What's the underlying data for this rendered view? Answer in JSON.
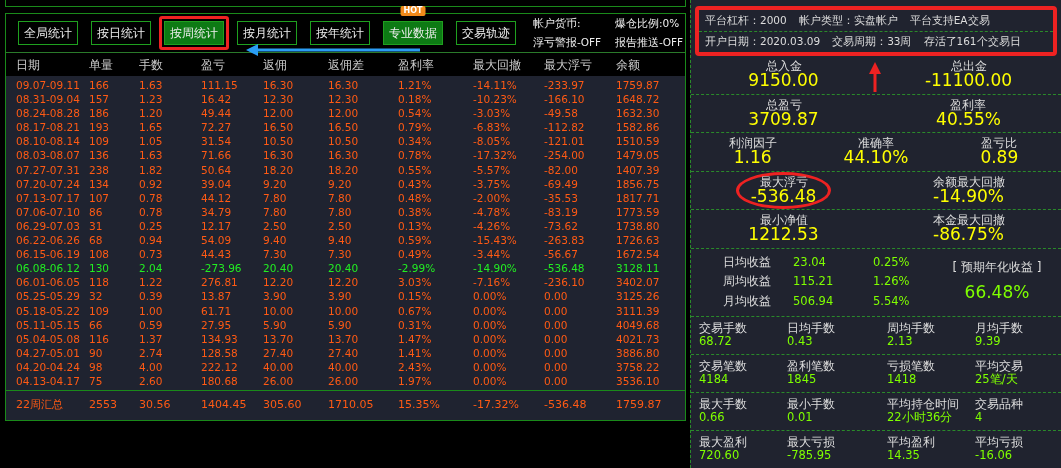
{
  "toolbar": {
    "buttons": [
      {
        "label": "全局统计",
        "selected": false,
        "highlighted": false
      },
      {
        "label": "按日统计",
        "selected": false,
        "highlighted": false
      },
      {
        "label": "按周统计",
        "selected": true,
        "highlighted": true
      },
      {
        "label": "按月统计",
        "selected": false,
        "highlighted": false
      },
      {
        "label": "按年统计",
        "selected": false,
        "highlighted": false
      },
      {
        "label": "专业数据",
        "selected": true,
        "highlighted": false,
        "badge": "HOT"
      },
      {
        "label": "交易轨迹",
        "selected": false,
        "highlighted": false
      }
    ],
    "info": [
      "帐户货币:",
      "爆仓比例:0%",
      "浮亏警报-OFF",
      "报告推送-OFF"
    ]
  },
  "table": {
    "columns": [
      "日期",
      "单量",
      "手数",
      "盈亏",
      "返佣",
      "返佣差",
      "盈利率",
      "最大回撤",
      "最大浮亏",
      "余额"
    ],
    "rows": [
      {
        "negative": false,
        "cells": [
          "09.07-09.11",
          "166",
          "1.63",
          "111.15",
          "16.30",
          "16.30",
          "1.21%",
          "-14.11%",
          "-233.97",
          "1759.87"
        ]
      },
      {
        "negative": false,
        "cells": [
          "08.31-09.04",
          "157",
          "1.23",
          "16.42",
          "12.30",
          "12.30",
          "0.18%",
          "-10.23%",
          "-166.10",
          "1648.72"
        ]
      },
      {
        "negative": false,
        "cells": [
          "08.24-08.28",
          "186",
          "1.20",
          "49.44",
          "12.00",
          "12.00",
          "0.54%",
          "-3.03%",
          "-49.58",
          "1632.30"
        ]
      },
      {
        "negative": false,
        "cells": [
          "08.17-08.21",
          "193",
          "1.65",
          "72.27",
          "16.50",
          "16.50",
          "0.79%",
          "-6.83%",
          "-112.82",
          "1582.86"
        ]
      },
      {
        "negative": false,
        "cells": [
          "08.10-08.14",
          "109",
          "1.05",
          "31.54",
          "10.50",
          "10.50",
          "0.34%",
          "-8.05%",
          "-121.01",
          "1510.59"
        ]
      },
      {
        "negative": false,
        "cells": [
          "08.03-08.07",
          "136",
          "1.63",
          "71.66",
          "16.30",
          "16.30",
          "0.78%",
          "-17.32%",
          "-254.00",
          "1479.05"
        ]
      },
      {
        "negative": false,
        "cells": [
          "07.27-07.31",
          "238",
          "1.82",
          "50.64",
          "18.20",
          "18.20",
          "0.55%",
          "-5.57%",
          "-82.00",
          "1407.39"
        ]
      },
      {
        "negative": false,
        "cells": [
          "07.20-07.24",
          "134",
          "0.92",
          "39.04",
          "9.20",
          "9.20",
          "0.43%",
          "-3.75%",
          "-69.49",
          "1856.75"
        ]
      },
      {
        "negative": false,
        "cells": [
          "07.13-07.17",
          "107",
          "0.78",
          "44.12",
          "7.80",
          "7.80",
          "0.48%",
          "-2.00%",
          "-35.53",
          "1817.71"
        ]
      },
      {
        "negative": false,
        "cells": [
          "07.06-07.10",
          "86",
          "0.78",
          "34.79",
          "7.80",
          "7.80",
          "0.38%",
          "-4.78%",
          "-83.19",
          "1773.59"
        ]
      },
      {
        "negative": false,
        "cells": [
          "06.29-07.03",
          "31",
          "0.25",
          "12.17",
          "2.50",
          "2.50",
          "0.13%",
          "-4.26%",
          "-73.62",
          "1738.80"
        ]
      },
      {
        "negative": false,
        "cells": [
          "06.22-06.26",
          "68",
          "0.94",
          "54.09",
          "9.40",
          "9.40",
          "0.59%",
          "-15.43%",
          "-263.83",
          "1726.63"
        ]
      },
      {
        "negative": false,
        "cells": [
          "06.15-06.19",
          "108",
          "0.73",
          "44.43",
          "7.30",
          "7.30",
          "0.49%",
          "-3.44%",
          "-56.67",
          "1672.54"
        ]
      },
      {
        "negative": true,
        "cells": [
          "06.08-06.12",
          "130",
          "2.04",
          "-273.96",
          "20.40",
          "20.40",
          "-2.99%",
          "-14.90%",
          "-536.48",
          "3128.11"
        ]
      },
      {
        "negative": false,
        "cells": [
          "06.01-06.05",
          "118",
          "1.22",
          "276.81",
          "12.20",
          "12.20",
          "3.03%",
          "-7.16%",
          "-236.10",
          "3402.07"
        ]
      },
      {
        "negative": false,
        "cells": [
          "05.25-05.29",
          "32",
          "0.39",
          "13.87",
          "3.90",
          "3.90",
          "0.15%",
          "0.00%",
          "0.00",
          "3125.26"
        ]
      },
      {
        "negative": false,
        "cells": [
          "05.18-05.22",
          "109",
          "1.00",
          "61.71",
          "10.00",
          "10.00",
          "0.67%",
          "0.00%",
          "0.00",
          "3111.39"
        ]
      },
      {
        "negative": false,
        "cells": [
          "05.11-05.15",
          "66",
          "0.59",
          "27.95",
          "5.90",
          "5.90",
          "0.31%",
          "0.00%",
          "0.00",
          "4049.68"
        ]
      },
      {
        "negative": false,
        "cells": [
          "05.04-05.08",
          "116",
          "1.37",
          "134.93",
          "13.70",
          "13.70",
          "1.47%",
          "0.00%",
          "0.00",
          "4021.73"
        ]
      },
      {
        "negative": false,
        "cells": [
          "04.27-05.01",
          "90",
          "2.74",
          "128.58",
          "27.40",
          "27.40",
          "1.41%",
          "0.00%",
          "0.00",
          "3886.80"
        ]
      },
      {
        "negative": false,
        "cells": [
          "04.20-04.24",
          "98",
          "4.00",
          "222.12",
          "40.00",
          "40.00",
          "2.43%",
          "0.00%",
          "0.00",
          "3758.22"
        ]
      },
      {
        "negative": false,
        "cells": [
          "04.13-04.17",
          "75",
          "2.60",
          "180.68",
          "26.00",
          "26.00",
          "1.97%",
          "0.00%",
          "0.00",
          "3536.10"
        ]
      }
    ],
    "summary": [
      "22周汇总",
      "2553",
      "30.56",
      "1404.45",
      "305.60",
      "1710.05",
      "15.35%",
      "-17.32%",
      "-536.48",
      "1759.87"
    ]
  },
  "account": {
    "highlighted": true,
    "lines": [
      [
        "平台杠杆：2000",
        "帐户类型：实盘帐户",
        "平台支持EA交易"
      ],
      [
        "开户日期：2020.03.09",
        "交易周期：33周",
        "存活了161个交易日"
      ]
    ]
  },
  "key_stats": [
    [
      {
        "label": "总入金",
        "value": "9150.00",
        "highlighted": false
      },
      {
        "label": "总出金",
        "value": "-11100.00",
        "highlighted": false
      }
    ],
    [
      {
        "label": "总盈亏",
        "value": "3709.87",
        "highlighted": false
      },
      {
        "label": "盈利率",
        "value": "40.55%",
        "highlighted": false
      }
    ],
    [
      {
        "label": "利润因子",
        "value": "1.16",
        "highlighted": false
      },
      {
        "label": "准确率",
        "value": "44.10%",
        "highlighted": false
      },
      {
        "label": "盈亏比",
        "value": "0.89",
        "highlighted": false
      }
    ],
    [
      {
        "label": "最大浮亏",
        "value": "-536.48",
        "highlighted": true
      },
      {
        "label": "余额最大回撤",
        "value": "-14.90%",
        "highlighted": false
      }
    ],
    [
      {
        "label": "最小净值",
        "value": "1212.53",
        "highlighted": false
      },
      {
        "label": "本金最大回撤",
        "value": "-86.75%",
        "highlighted": false
      }
    ]
  ],
  "returns": {
    "rows": [
      {
        "label": "日均收益",
        "value": "23.04",
        "percent": "0.25%"
      },
      {
        "label": "周均收益",
        "value": "115.21",
        "percent": "1.26%"
      },
      {
        "label": "月均收益",
        "value": "506.94",
        "percent": "5.54%"
      }
    ],
    "annual_label": "[ 预期年化收益 ]",
    "annual_value": "66.48%"
  },
  "trade_stats": [
    [
      {
        "label": "交易手数",
        "value": "68.72"
      },
      {
        "label": "日均手数",
        "value": "0.43"
      },
      {
        "label": "周均手数",
        "value": "2.13"
      },
      {
        "label": "月均手数",
        "value": "9.39"
      }
    ],
    [
      {
        "label": "交易笔数",
        "value": "4184"
      },
      {
        "label": "盈利笔数",
        "value": "1845"
      },
      {
        "label": "亏损笔数",
        "value": "1418"
      },
      {
        "label": "平均交易",
        "value": "25笔/天"
      }
    ],
    [
      {
        "label": "最大手数",
        "value": "0.66"
      },
      {
        "label": "最小手数",
        "value": "0.01"
      },
      {
        "label": "平均持仓时间",
        "value": "22小时36分"
      },
      {
        "label": "交易品种",
        "value": "4"
      }
    ],
    [
      {
        "label": "最大盈利",
        "value": "720.60"
      },
      {
        "label": "最大亏损",
        "value": "-785.95"
      },
      {
        "label": "平均盈利",
        "value": "14.35"
      },
      {
        "label": "平均亏损",
        "value": "-16.06"
      }
    ]
  ]
}
